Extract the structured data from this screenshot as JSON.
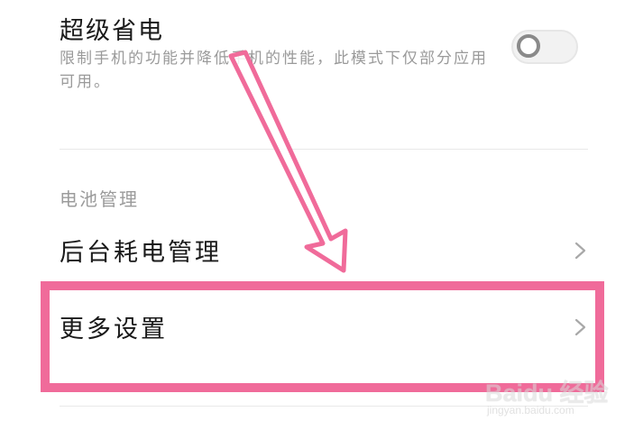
{
  "power_saving": {
    "title": "超级省电",
    "description": "限制手机的功能并降低手机的性能，此模式下仅部分应用可用。",
    "toggle_state": "off"
  },
  "battery_section": {
    "header": "电池管理",
    "items": [
      {
        "label": "后台耗电管理",
        "icon": "chevron-right-icon"
      },
      {
        "label": "更多设置",
        "icon": "chevron-right-icon"
      }
    ]
  },
  "annotation": {
    "highlight_color": "#f06b9a",
    "arrow_color": "#f06b9a"
  },
  "watermark": {
    "brand": "Baidu 经验",
    "url": "jingyan.baidu.com"
  }
}
